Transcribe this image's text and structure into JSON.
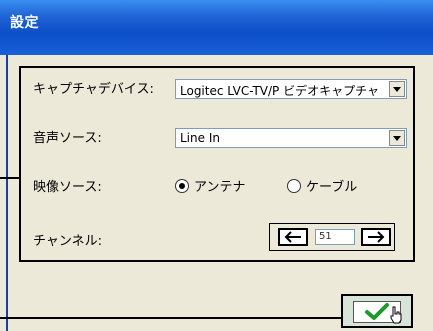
{
  "window": {
    "title": "設定"
  },
  "capture_device": {
    "label": "キャプチャデバイス:",
    "value": "Logitec LVC-TV/P ビデオキャプチャ"
  },
  "audio_source": {
    "label": "音声ソース:",
    "value": "Line In"
  },
  "video_source": {
    "label": "映像ソース:",
    "options": [
      {
        "label": "アンテナ",
        "selected": true
      },
      {
        "label": "ケーブル",
        "selected": false
      }
    ]
  },
  "channel": {
    "label": "チャンネル:",
    "value": "51",
    "prev_icon": "left-arrow-icon",
    "next_icon": "right-arrow-icon"
  },
  "ok_button": {
    "icon": "check-icon"
  },
  "colors": {
    "titlebar": "#0c4fc7",
    "checkmark": "#1f9a2a"
  }
}
